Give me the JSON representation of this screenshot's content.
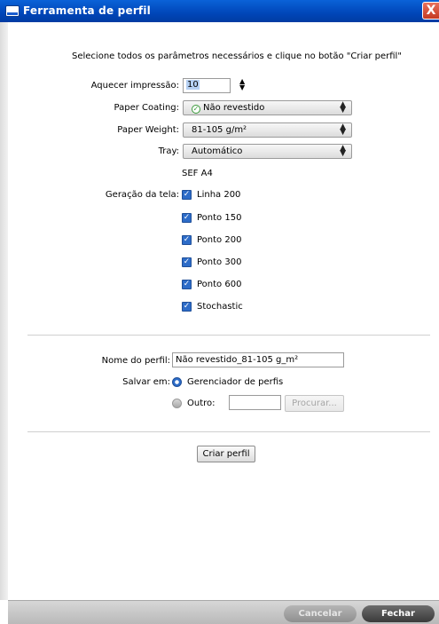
{
  "window": {
    "title": "Ferramenta de perfil",
    "close_glyph": "X"
  },
  "instruction": "Selecione todos os parâmetros necessários e clique no botão \"Criar perfil\"",
  "warmup": {
    "label": "Aquecer impressão:",
    "value": "10"
  },
  "paper_coating": {
    "label": "Paper Coating:",
    "value": "Não revestido",
    "icon": "green-check-icon"
  },
  "paper_weight": {
    "label": "Paper Weight:",
    "value": "81-105 g/m²"
  },
  "tray": {
    "label": "Tray:",
    "value": "Automático"
  },
  "sheet_info": "SEF A4",
  "screening": {
    "label": "Geração da tela:",
    "options": [
      {
        "label": "Linha 200",
        "checked": true
      },
      {
        "label": "Ponto 150",
        "checked": true
      },
      {
        "label": "Ponto 200",
        "checked": true
      },
      {
        "label": "Ponto 300",
        "checked": true
      },
      {
        "label": "Ponto 600",
        "checked": true
      },
      {
        "label": "Stochastic",
        "checked": true
      }
    ]
  },
  "profile_name": {
    "label": "Nome do perfil:",
    "value": "Não revestido_81-105 g_m²"
  },
  "save_in": {
    "label": "Salvar em:",
    "options": [
      {
        "label": "Gerenciador de perfis",
        "selected": true
      },
      {
        "label": "Outro:",
        "selected": false
      }
    ],
    "browse_label": "Procurar..."
  },
  "create_button": "Criar perfil",
  "footer": {
    "cancel_label": "Cancelar",
    "close_label": "Fechar"
  },
  "colors": {
    "titlebar": "#0046b8",
    "checkbox": "#2d6cc8",
    "close_pill": "#3a3a3a"
  }
}
